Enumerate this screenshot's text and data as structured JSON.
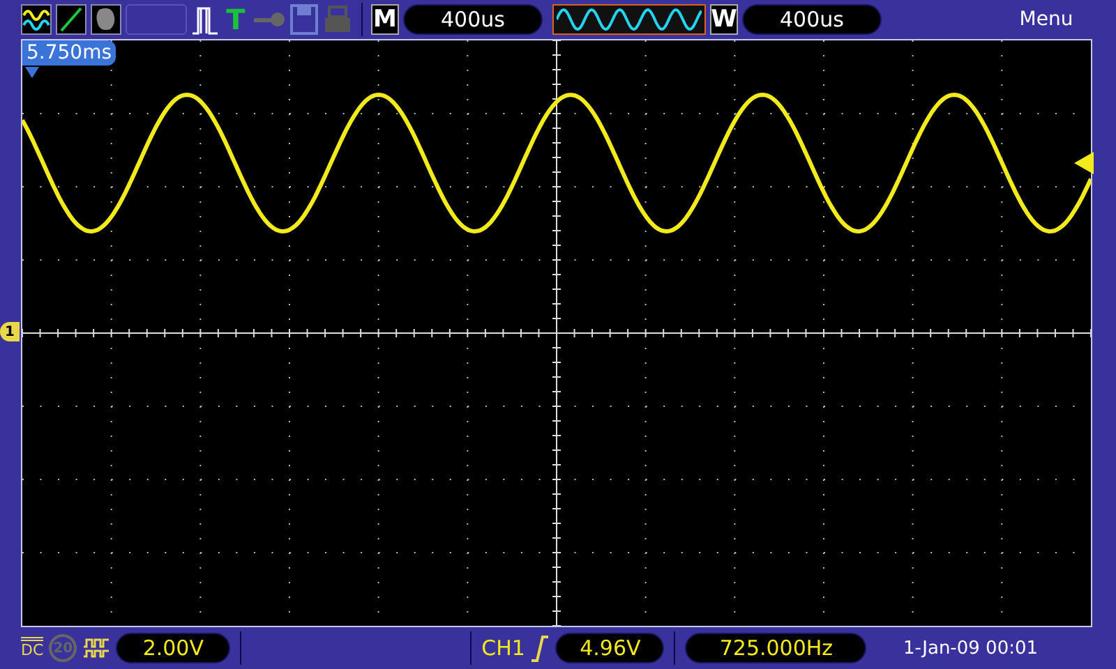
{
  "toolbar": {
    "trigger_status": "T",
    "timebase_label": "M",
    "timebase": "400us",
    "window_label": "W",
    "window_timebase": "400us",
    "menu": "Menu"
  },
  "screen": {
    "trigger_position": "5.750ms",
    "channel_marker": "1"
  },
  "channel": {
    "coupling": "DC",
    "bandwidth_limit": {
      "label": "20",
      "on": false
    },
    "scale": "2.00V"
  },
  "trigger": {
    "source": "CH1",
    "edge": {
      "kind": "rising"
    },
    "level": "4.96V"
  },
  "frequency": "725.000Hz",
  "datetime": "1-Jan-09 00:01"
}
